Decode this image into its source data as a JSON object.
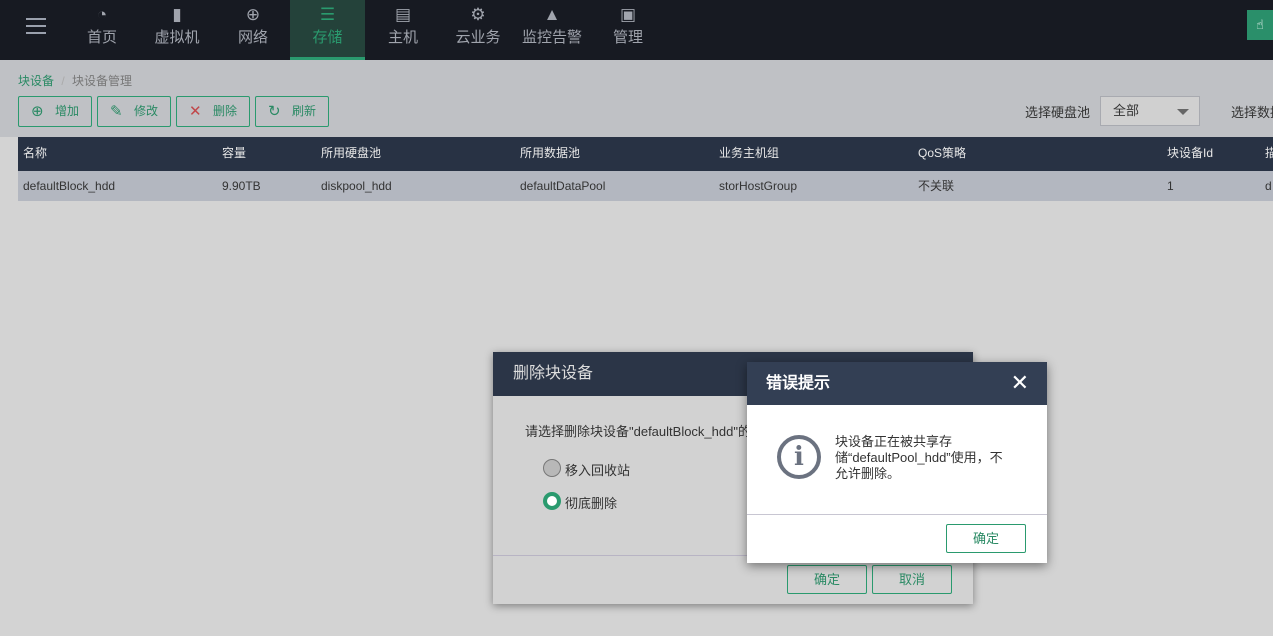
{
  "nav": {
    "items": [
      {
        "label": "首页",
        "icon": "dashboard-icon"
      },
      {
        "label": "虚拟机",
        "icon": "vm-icon"
      },
      {
        "label": "网络",
        "icon": "globe-icon"
      },
      {
        "label": "存储",
        "icon": "database-icon",
        "active": true
      },
      {
        "label": "主机",
        "icon": "server-icon"
      },
      {
        "label": "云业务",
        "icon": "gear-icon"
      },
      {
        "label": "监控告警",
        "icon": "bell-icon"
      },
      {
        "label": "管理",
        "icon": "monitor-icon"
      }
    ]
  },
  "breadcrumb": {
    "root": "块设备",
    "sep": "/",
    "current": "块设备管理"
  },
  "toolbar": {
    "add": "增加",
    "edit": "修改",
    "delete": "删除",
    "refresh": "刷新"
  },
  "filters": {
    "disk_pool_label": "选择硬盘池",
    "disk_pool_value": "全部",
    "data_pool_label": "选择数据池"
  },
  "table": {
    "columns": [
      "名称",
      "容量",
      "所用硬盘池",
      "所用数据池",
      "业务主机组",
      "QoS策略",
      "块设备Id",
      "描述"
    ],
    "rows": [
      [
        "defaultBlock_hdd",
        "9.90TB",
        "diskpool_hdd",
        "defaultDataPool",
        "storHostGroup",
        "不关联",
        "1",
        "d"
      ]
    ]
  },
  "delete_dialog": {
    "title": "删除块设备",
    "message": "请选择删除块设备\"defaultBlock_hdd\"的",
    "options": [
      "移入回收站",
      "彻底删除"
    ],
    "selected": "彻底删除",
    "ok": "确定",
    "cancel": "取消"
  },
  "error_dialog": {
    "title": "错误提示",
    "close": "✕",
    "message": "块设备正在被共享存储“defaultPool_hdd”使用，不允许删除。",
    "ok": "确定"
  }
}
